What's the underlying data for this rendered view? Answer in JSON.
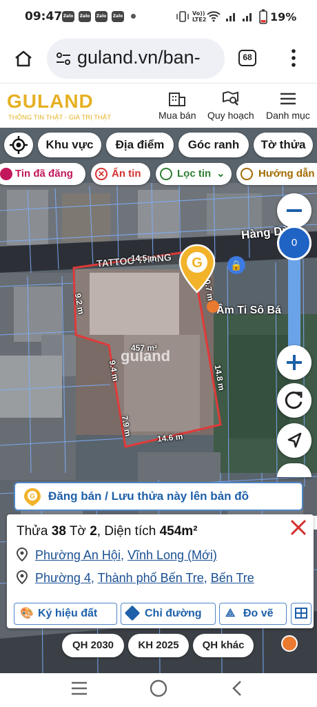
{
  "status": {
    "time": "09:47",
    "notif_apps": [
      "Zalo",
      "Zalo",
      "Zalo",
      "Zalo"
    ],
    "network": "VoLTE2",
    "battery": "19%"
  },
  "browser": {
    "url": "guland.vn/ban-",
    "tab_count": "68"
  },
  "header": {
    "logo": "GULAND",
    "tagline": "THÔNG TIN THẬT - GIÁ TRỊ THẬT",
    "nav": [
      {
        "label": "Mua bán"
      },
      {
        "label": "Quy hoạch"
      },
      {
        "label": "Danh mục"
      }
    ]
  },
  "filters": {
    "chips": [
      "Khu vực",
      "Địa điểm",
      "Góc ranh",
      "Tờ thửa"
    ],
    "secondary": [
      "Tin đã đăng",
      "Ẩn tin",
      "Lọc tin",
      "Hướng dẫn"
    ]
  },
  "map": {
    "street_label": "Hàng Dừa",
    "street_label2": "TATTOO THANG",
    "poi_label": "Âm Ti Sô Bá",
    "watermark": "guland",
    "zoom_value": "0",
    "area_label": "457 m²",
    "edges": [
      "14.5 m",
      "10.7 m",
      "9.2 m",
      "9.4 m",
      "14.8 m",
      "7.9 m",
      "14.6 m"
    ]
  },
  "save_bar": {
    "label": "Đăng bán / Lưu thửa này lên bản đồ"
  },
  "info": {
    "parcel_prefix": "Thửa",
    "parcel_no": "38",
    "sheet_prefix": "Tờ",
    "sheet_no": "2",
    "area_prefix": ", Diện tích",
    "area_value": "454m²",
    "loc1_ward": "Phường An Hội",
    "loc1_city": "Vĩnh Long (Mới)",
    "loc2_ward": "Phường 4",
    "loc2_city": "Thành phố Bến Tre",
    "loc2_province": "Bến Tre",
    "actions": [
      "Ký hiệu đất",
      "Chỉ đường",
      "Đo vẽ"
    ]
  },
  "planning": [
    "QH 2030",
    "KH 2025",
    "QH khác"
  ],
  "colors": {
    "brand": "#e5b022",
    "link": "#1a4f93",
    "parcel_border": "#e03a3a",
    "zoom_blue": "#2f7fd4"
  }
}
